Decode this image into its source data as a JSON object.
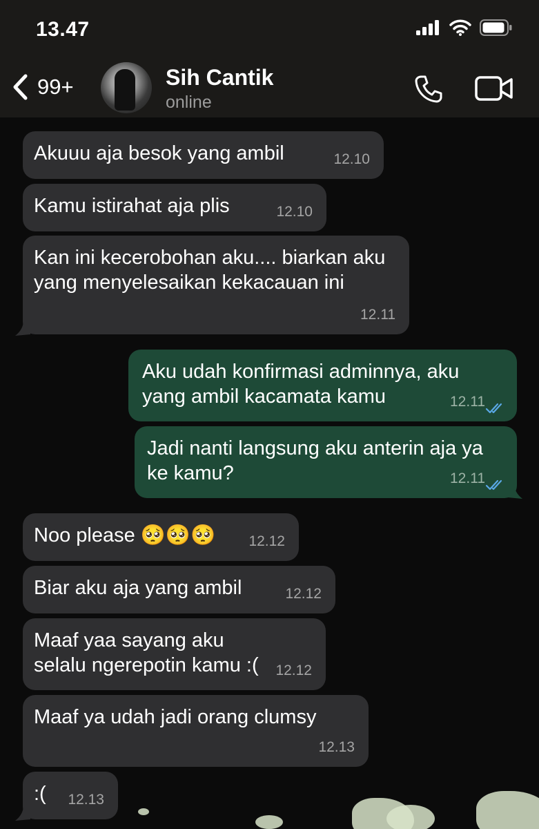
{
  "status_bar": {
    "time": "13.47"
  },
  "header": {
    "back_count": "99+",
    "contact_name": "Sih Cantik",
    "contact_status": "online"
  },
  "colors": {
    "incoming": "#2f2f31",
    "outgoing": "#1e4a37",
    "read_ticks": "#5aa8e6"
  },
  "messages": [
    {
      "dir": "in",
      "text": "Akuuu aja besok yang ambil",
      "time": "12.10"
    },
    {
      "dir": "in",
      "text": "Kamu istirahat aja plis",
      "time": "12.10"
    },
    {
      "dir": "in",
      "text": "Kan ini kecerobohan aku.... biarkan aku yang menyelesaikan kekacauan ini",
      "time": "12.11"
    },
    {
      "dir": "out",
      "text": "Aku udah konfirmasi adminnya, aku yang ambil kacamata kamu",
      "time": "12.11",
      "status": "read"
    },
    {
      "dir": "out",
      "text": "Jadi nanti langsung aku anterin aja ya ke kamu?",
      "time": "12.11",
      "status": "read"
    },
    {
      "dir": "in",
      "text": "Noo please 🥺🥺🥺",
      "time": "12.12"
    },
    {
      "dir": "in",
      "text": "Biar aku aja yang ambil",
      "time": "12.12"
    },
    {
      "dir": "in",
      "text": "Maaf yaa sayang aku selalu ngerepotin kamu :(",
      "time": "12.12"
    },
    {
      "dir": "in",
      "text": "Maaf ya udah jadi orang clumsy",
      "time": "12.13"
    },
    {
      "dir": "in",
      "text": ":(",
      "time": "12.13"
    }
  ]
}
